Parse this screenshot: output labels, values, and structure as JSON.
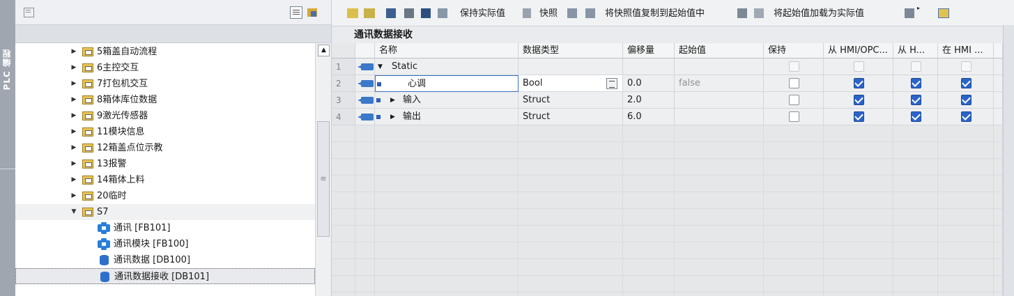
{
  "side_strip": {
    "label": "PLC 编程"
  },
  "tree": {
    "items": [
      {
        "label": "5箱盖自动流程",
        "kind": "folder",
        "expanded": false
      },
      {
        "label": "6主控交互",
        "kind": "folder",
        "expanded": false
      },
      {
        "label": "7打包机交互",
        "kind": "folder",
        "expanded": false
      },
      {
        "label": "8箱体库位数据",
        "kind": "folder",
        "expanded": false
      },
      {
        "label": "9激光传感器",
        "kind": "folder",
        "expanded": false
      },
      {
        "label": "11模块信息",
        "kind": "folder",
        "expanded": false
      },
      {
        "label": "12箱盖点位示教",
        "kind": "folder",
        "expanded": false
      },
      {
        "label": "13报警",
        "kind": "folder",
        "expanded": false
      },
      {
        "label": "14箱体上料",
        "kind": "folder",
        "expanded": false
      },
      {
        "label": "20临时",
        "kind": "folder",
        "expanded": false
      },
      {
        "label": "S7",
        "kind": "folder",
        "expanded": true
      },
      {
        "label": "通讯 [FB101]",
        "kind": "fb"
      },
      {
        "label": "通讯模块 [FB100]",
        "kind": "fb"
      },
      {
        "label": "通讯数据 [DB100]",
        "kind": "db"
      },
      {
        "label": "通讯数据接收 [DB101]",
        "kind": "db",
        "selected": true
      }
    ]
  },
  "toolbar": {
    "keep_actual": "保持实际值",
    "snapshot": "快照",
    "copy_snapshot": "将快照值复制到起始值中",
    "load_start": "将起始值加载为实际值"
  },
  "db_title": "通讯数据接收",
  "table": {
    "headers": [
      "名称",
      "数据类型",
      "偏移量",
      "起始值",
      "保持",
      "从 HMI/OPC...",
      "从 H...",
      "在 HMI ..."
    ],
    "rows": [
      {
        "num": "1",
        "name": "Static",
        "type": "",
        "offset": "",
        "start": "",
        "keep": false,
        "hmi_opc": false,
        "from_h": false,
        "in_hmi": false,
        "is_section": true
      },
      {
        "num": "2",
        "name": "心调",
        "type": "Bool",
        "offset": "0.0",
        "start": "false",
        "keep": false,
        "hmi_opc": true,
        "from_h": true,
        "in_hmi": true
      },
      {
        "num": "3",
        "name": "输入",
        "type": "Struct",
        "offset": "2.0",
        "start": "",
        "keep": false,
        "hmi_opc": true,
        "from_h": true,
        "in_hmi": true,
        "has_children": true
      },
      {
        "num": "4",
        "name": "输出",
        "type": "Struct",
        "offset": "6.0",
        "start": "",
        "keep": false,
        "hmi_opc": true,
        "from_h": true,
        "in_hmi": true,
        "has_children": true
      }
    ]
  },
  "colors": {
    "accent": "#2a64c8",
    "folder": "#e7c45a"
  }
}
